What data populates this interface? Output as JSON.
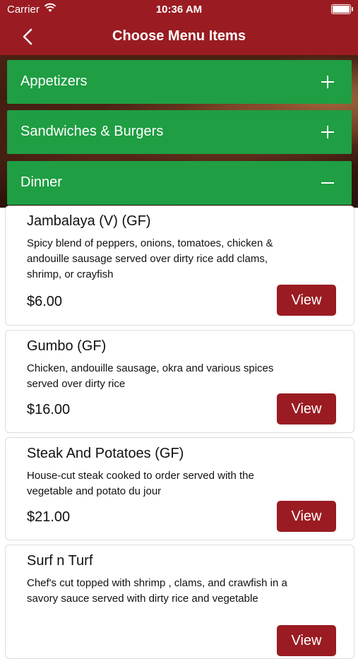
{
  "status_bar": {
    "carrier": "Carrier",
    "time": "10:36 AM"
  },
  "header": {
    "title": "Choose Menu Items"
  },
  "categories": [
    {
      "label": "Appetizers",
      "icon": "plus-icon"
    },
    {
      "label": "Sandwiches & Burgers",
      "icon": "plus-icon"
    },
    {
      "label": "Dinner",
      "icon": "minus-icon"
    }
  ],
  "items": [
    {
      "name": "Jambalaya (V) (GF)",
      "description": "Spicy blend of peppers, onions, tomatoes, chicken & andouille sausage served over dirty rice  add clams, shrimp, or crayfish",
      "price": "$6.00",
      "button": "View"
    },
    {
      "name": "Gumbo (GF)",
      "description": "Chicken, andouille sausage, okra and various spices served over dirty rice",
      "price": "$16.00",
      "button": "View"
    },
    {
      "name": "Steak And Potatoes (GF)",
      "description": "House-cut steak cooked to order served with the vegetable and potato du jour",
      "price": "$21.00",
      "button": "View"
    },
    {
      "name": "Surf n Turf",
      "description": "Chef's cut topped with shrimp , clams, and crawfish in a savory sauce  served with dirty rice and vegetable",
      "price": "",
      "button": "View"
    }
  ],
  "colors": {
    "header": "#9a1c22",
    "category": "#1f9e43",
    "button": "#9a1c22"
  }
}
